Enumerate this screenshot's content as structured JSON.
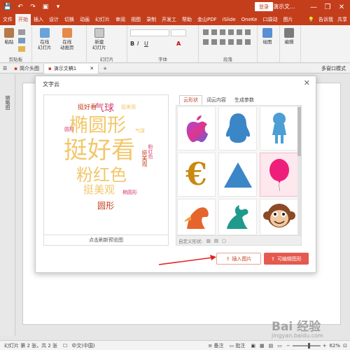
{
  "window": {
    "title": "演示文...",
    "login": "登录",
    "minimize": "—",
    "restore": "❐",
    "close": "✕"
  },
  "menu": {
    "items": [
      "文件",
      "开始",
      "插入",
      "设计",
      "切换",
      "动画",
      "幻灯片",
      "审阅",
      "视图",
      "录制",
      "开发工",
      "帮助",
      "金山PDF",
      "iSlide",
      "OneKe",
      "口袋动",
      "图片"
    ],
    "active": "开始",
    "tell_me": "告诉我",
    "share": "共享"
  },
  "ribbon": {
    "clipboard": {
      "paste": "粘贴",
      "label": "剪贴板"
    },
    "online": {
      "slides": "在线\n幻灯片",
      "animation": "在线\n动画页"
    },
    "new_slide": {
      "label": "新建\n幻灯片",
      "group": "幻灯片"
    },
    "font_group": "字体",
    "paragraph_group": "段落",
    "draw": "绘图",
    "edit": "编辑"
  },
  "doc_tabs": [
    {
      "name": "简介头图",
      "active": false
    },
    {
      "name": "演示文稿1",
      "active": true
    }
  ],
  "doc_tabs_right": "多窗口模式",
  "left_pane_label": "缩略图",
  "dialog": {
    "title": "文字云",
    "close": "✕",
    "preview_button": "点击刷新预览图",
    "tabs": [
      "云形状",
      "词云内容",
      "生成参数"
    ],
    "active_tab": "云形状",
    "custom_shape_label": "自定义形状:",
    "insert_button": "插入图片",
    "editable_button": "可编辑图形"
  },
  "word_cloud": [
    {
      "text": "挺好看",
      "color": "#f2c76a"
    },
    {
      "text": "椭圆形",
      "color": "#f2c76a"
    },
    {
      "text": "粉红色",
      "color": "#f2c76a"
    },
    {
      "text": "挺美观",
      "color": "#f2c76a"
    },
    {
      "text": "气球",
      "color": "#d6416e"
    },
    {
      "text": "圆形",
      "color": "#c43e1c"
    },
    {
      "text": "挺好看",
      "color": "#c43e1c"
    },
    {
      "text": "椭圆形",
      "color": "#d6416e"
    },
    {
      "text": "挺美观",
      "color": "#c43e1c"
    },
    {
      "text": "粉红色",
      "color": "#d6416e"
    },
    {
      "text": "挺美观",
      "color": "#f2c76a"
    },
    {
      "text": "圆形",
      "color": "#d6416e"
    },
    {
      "text": "气球",
      "color": "#f2c76a"
    }
  ],
  "shapes": [
    "apple-logo",
    "penguin",
    "girl-silhouette",
    "euro-sign",
    "triangle",
    "balloon",
    "horse-head",
    "pegasus",
    "monkey-face"
  ],
  "selected_shape": "balloon",
  "status": {
    "slide_info": "幻灯片 第 2 张，共 2 张",
    "language": "中文(中国)",
    "notes": "备注",
    "comments": "批注",
    "zoom": "62%"
  },
  "watermark": {
    "brand": "Bai 经验",
    "url": "jingyan.baidu.com"
  }
}
